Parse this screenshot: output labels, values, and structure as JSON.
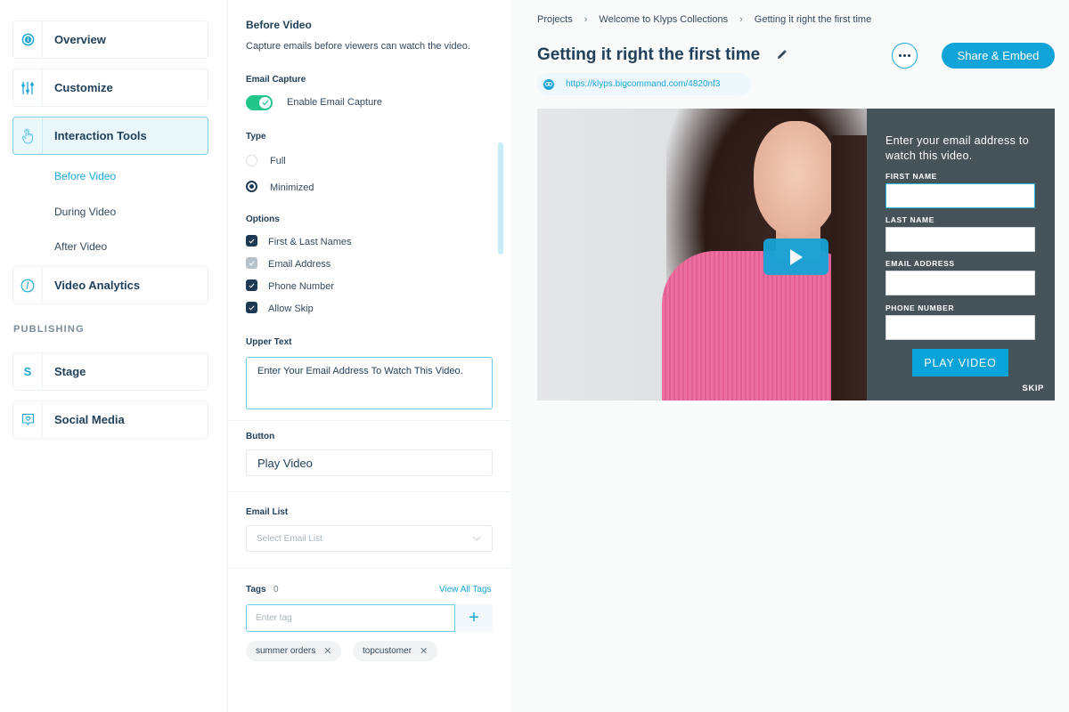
{
  "colors": {
    "accent": "#1ba6d8",
    "primary_text": "#21405a",
    "toggle_on": "#22c58a",
    "checkbox": "#1d3a55",
    "overlay_bg": "#465359",
    "play_button": "#16a3d6"
  },
  "sidebar": {
    "items": [
      {
        "label": "Overview",
        "icon": "info-circle-icon"
      },
      {
        "label": "Customize",
        "icon": "sliders-icon"
      },
      {
        "label": "Interaction Tools",
        "icon": "hand-pointer-icon",
        "active": true
      },
      {
        "label": "Video Analytics",
        "icon": "clock-icon"
      }
    ],
    "sub_items": [
      {
        "label": "Before Video",
        "active": true
      },
      {
        "label": "During Video"
      },
      {
        "label": "After Video"
      }
    ],
    "publishing_heading": "PUBLISHING",
    "publishing_items": [
      {
        "label": "Stage",
        "icon_text": "S"
      },
      {
        "label": "Social Media",
        "icon": "chat-heart-icon"
      }
    ]
  },
  "settings": {
    "title": "Before Video",
    "description": "Capture emails before viewers can watch the video.",
    "email_capture": {
      "label": "Email Capture",
      "toggle_label": "Enable Email Capture",
      "enabled": true
    },
    "type": {
      "label": "Type",
      "options": [
        {
          "label": "Full",
          "selected": false
        },
        {
          "label": "Minimized",
          "selected": true
        }
      ]
    },
    "options": {
      "label": "Options",
      "items": [
        {
          "label": "First & Last Names",
          "checked": true,
          "disabled": false
        },
        {
          "label": "Email Address",
          "checked": true,
          "disabled": true
        },
        {
          "label": "Phone Number",
          "checked": true,
          "disabled": false
        },
        {
          "label": "Allow Skip",
          "checked": true,
          "disabled": false
        }
      ]
    },
    "upper_text": {
      "label": "Upper Text",
      "value": "Enter Your Email Address To Watch This Video."
    },
    "button": {
      "label": "Button",
      "value": "Play Video"
    },
    "email_list": {
      "label": "Email List",
      "placeholder": "Select Email List"
    },
    "tags": {
      "label": "Tags",
      "count": "0",
      "view_all": "View All Tags",
      "placeholder": "Enter tag",
      "add_icon": "+",
      "chips": [
        "summer orders",
        "topcustomer"
      ]
    }
  },
  "main": {
    "breadcrumb": [
      "Projects",
      "Welcome to Klyps Collections",
      "Getting it right the first time"
    ],
    "breadcrumb_sep": ">",
    "title": "Getting it right the first time",
    "share_label": "Share & Embed",
    "url": "https://klyps.bigcommand.com/4820nf3",
    "video_overlay": {
      "heading": "Enter your email address to watch this video.",
      "fields": [
        "FIRST NAME",
        "LAST NAME",
        "EMAIL ADDRESS",
        "PHONE NUMBER"
      ],
      "play_label": "PLAY VIDEO",
      "skip_label": "SKIP"
    }
  }
}
